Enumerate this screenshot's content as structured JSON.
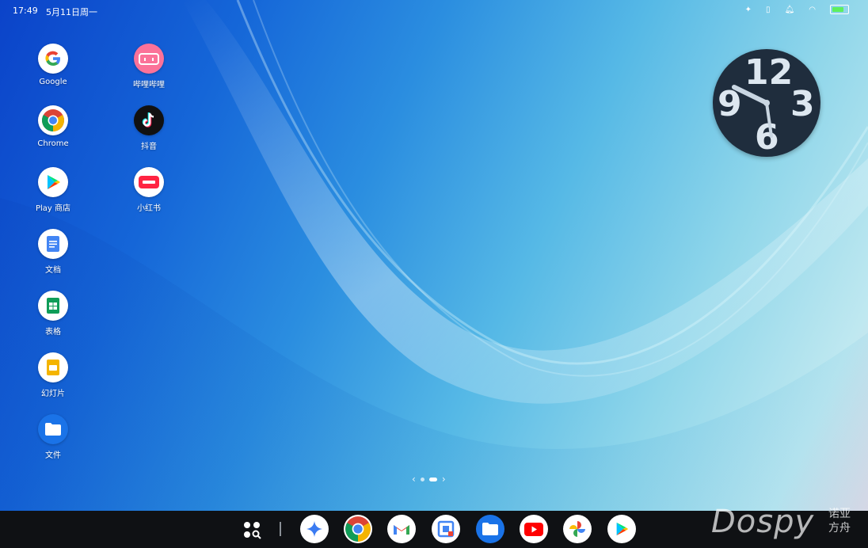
{
  "status": {
    "time": "17:49",
    "date": "5月11日周一",
    "icons": [
      "sparkle-icon",
      "vibrate-icon",
      "notification-icon",
      "wifi-icon",
      "battery-icon"
    ]
  },
  "apps": [
    {
      "label": "Google",
      "icon": "google-icon"
    },
    {
      "label": "哔哩哔哩",
      "icon": "bilibili-icon"
    },
    {
      "label": "Chrome",
      "icon": "chrome-icon"
    },
    {
      "label": "抖音",
      "icon": "tiktok-icon"
    },
    {
      "label": "Play 商店",
      "icon": "play-store-icon"
    },
    {
      "label": "小红书",
      "icon": "xiaohongshu-icon"
    },
    {
      "label": "文档",
      "icon": "docs-icon"
    },
    {
      "label": "表格",
      "icon": "sheets-icon"
    },
    {
      "label": "幻灯片",
      "icon": "slides-icon"
    },
    {
      "label": "文件",
      "icon": "files-icon"
    }
  ],
  "clock": {
    "numerals": [
      "12",
      "3",
      "6",
      "9"
    ]
  },
  "pager": {
    "prev": "‹",
    "next": "›",
    "pages": 2,
    "current": 2
  },
  "taskbar": {
    "items": [
      "launcher-icon",
      "gemini-icon",
      "chrome-icon",
      "gmail-icon",
      "calendar-icon",
      "files-icon",
      "youtube-icon",
      "photos-icon",
      "play-store-icon"
    ]
  },
  "watermark": {
    "brand": "Dospy",
    "line1": "诺亚",
    "line2": "方舟"
  },
  "colors": {
    "taskbar": "#0f1114",
    "clock_face": "#1f2d3d",
    "wallpaper_start": "#0b43c9",
    "wallpaper_end": "#bfe8f0"
  }
}
